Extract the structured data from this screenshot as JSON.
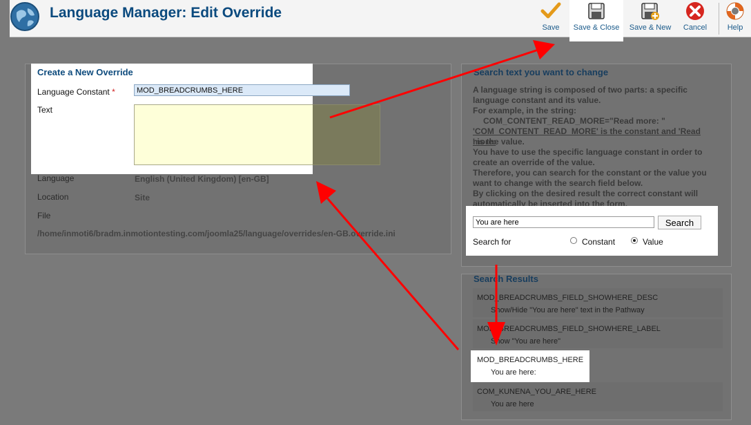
{
  "header": {
    "title": "Language Manager: Edit Override",
    "toolbar": [
      {
        "label": "Save",
        "icon": "check-icon"
      },
      {
        "label": "Save & Close",
        "icon": "floppy-disk-icon"
      },
      {
        "label": "Save & New",
        "icon": "floppy-disk-plus-icon"
      },
      {
        "label": "Cancel",
        "icon": "cancel-x-icon"
      },
      {
        "label": "Help",
        "icon": "lifebuoy-icon"
      }
    ]
  },
  "form": {
    "legend": "Create a New Override",
    "constant_label": "Language Constant",
    "required_mark": "*",
    "constant_value": "MOD_BREADCRUMBS_HERE",
    "text_label": "Text",
    "text_value": "",
    "language_label": "Language",
    "language_value": "English (United Kingdom) [en-GB]",
    "location_label": "Location",
    "location_value": "Site",
    "file_label": "File",
    "file_value": "/home/inmoti6/bradm.inmotiontesting.com/joomla25/language/overrides/en-GB.override.ini"
  },
  "search": {
    "legend": "Search text you want to change",
    "lines": [
      "A language string is composed of two parts: a specific",
      "language constant and its value.",
      "For example, in the string:",
      "COM_CONTENT_READ_MORE=\"Read more: \"",
      "'COM_CONTENT_READ_MORE' is the constant and 'Read more:",
      "' is the value.",
      "You have to use the specific language constant in order to",
      "create an override of the value.",
      "Therefore, you can search for the constant or the value you",
      "want to change with the search field below.",
      "By clicking on the desired result the correct constant will",
      "automatically be inserted into the form."
    ],
    "input_value": "You are here",
    "button_label": "Search",
    "search_for_label": "Search for",
    "option_constant": "Constant",
    "option_value": "Value",
    "selected": "Value"
  },
  "results": {
    "legend": "Search Results",
    "items": [
      {
        "constant": "MOD_BREADCRUMBS_FIELD_SHOWHERE_DESC",
        "value": "Show/Hide \"You are here\" text in the Pathway"
      },
      {
        "constant": "MOD_BREADCRUMBS_FIELD_SHOWHERE_LABEL",
        "value": "Show \"You are here\""
      },
      {
        "constant": "MOD_BREADCRUMBS_HERE",
        "value": "You are here:"
      },
      {
        "constant": "COM_KUNENA_YOU_ARE_HERE",
        "value": "You are here"
      }
    ]
  },
  "colors": {
    "title": "#0b4a7e",
    "legend": "#0e4b7d",
    "annotation_arrow": "#ff0000",
    "text_area": "#feffd9",
    "constant_field": "#dbe9f8"
  }
}
